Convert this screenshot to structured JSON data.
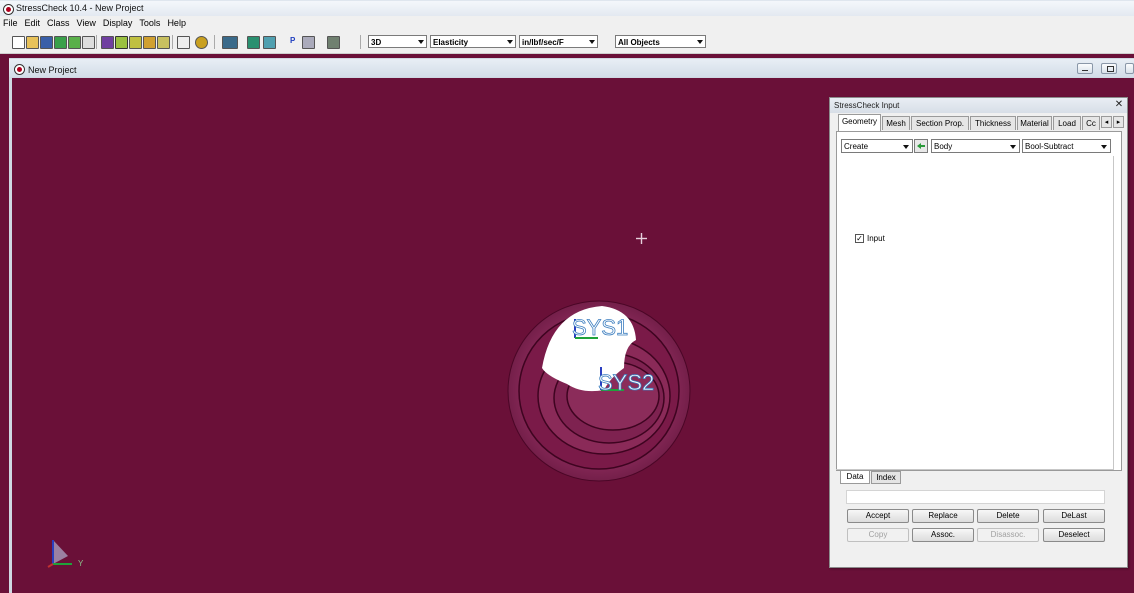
{
  "window": {
    "title": "StressCheck 10.4 - New Project"
  },
  "menu": [
    "File",
    "Edit",
    "Class",
    "View",
    "Display",
    "Tools",
    "Help"
  ],
  "toolbar": {
    "dimension": "3D",
    "analysis": "Elasticity",
    "units": "in/lbf/sec/F",
    "filter": "All Objects",
    "p_label": "P"
  },
  "document": {
    "title": "New Project"
  },
  "dialog": {
    "title": "StressCheck Input",
    "close": "✕",
    "tabs": [
      "Geometry",
      "Mesh",
      "Section Prop.",
      "Thickness",
      "Material",
      "Load",
      "Cc"
    ],
    "active_tab": "Geometry",
    "action": "Create",
    "object": "Body",
    "method": "Bool-Subtract",
    "input_checkbox": {
      "label": "Input",
      "checked": true,
      "mark": "✓"
    },
    "bottom_tabs": [
      "Data",
      "Index"
    ],
    "buttons": {
      "accept": "Accept",
      "replace": "Replace",
      "delete": "Delete",
      "delast": "DeLast",
      "copy": "Copy",
      "assoc": "Assoc.",
      "disassoc": "Disassoc.",
      "deselect": "Deselect"
    }
  },
  "viewport": {
    "background": "#6a1038",
    "labels": [
      "SYS1",
      "SYS2"
    ],
    "triad_axis": "Y"
  },
  "colors": {
    "model_surface": "#7a1a48",
    "label_color": "#3e7fc0",
    "axis_green": "#1fa23a",
    "axis_blue": "#2a3ec0"
  }
}
